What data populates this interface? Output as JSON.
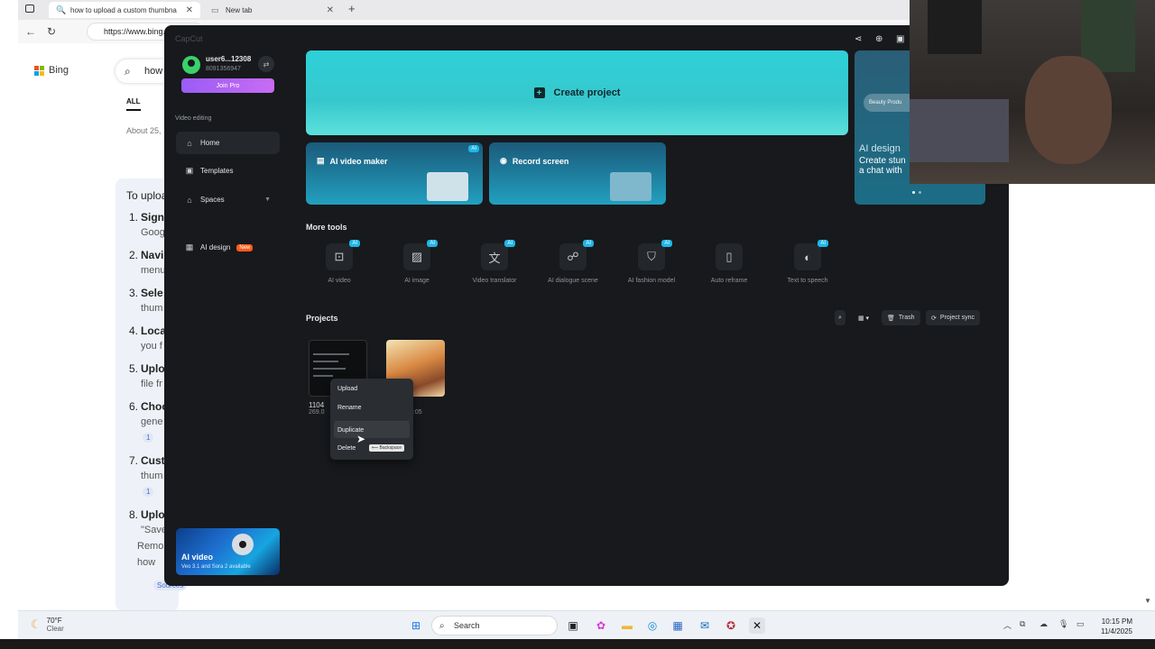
{
  "browser": {
    "tabs": [
      {
        "label": "how to upload a custom thumbna",
        "close": "✕"
      },
      {
        "label": "New tab",
        "close": "✕"
      }
    ],
    "new_tab": "+",
    "url": "https://www.bing.com"
  },
  "bing": {
    "logo": "Bing",
    "query": "how",
    "tab_all": "ALL",
    "about": "About 25,",
    "answer_intro": "To uploa",
    "steps": [
      {
        "num": "1.",
        "title": "Sign",
        "sub": "Goog"
      },
      {
        "num": "2.",
        "title": "Navi",
        "sub": "menu"
      },
      {
        "num": "3.",
        "title": "Sele",
        "sub": "thum"
      },
      {
        "num": "4.",
        "title": "Loca",
        "sub": "you f"
      },
      {
        "num": "5.",
        "title": "Uplo",
        "sub": "file fr"
      },
      {
        "num": "6.",
        "title": "Choo",
        "sub": "gene"
      },
      {
        "num": "7.",
        "title": "Custo",
        "sub": "thum"
      },
      {
        "num": "8.",
        "title": "Uplo",
        "sub": "\"Save"
      }
    ],
    "tail_lines": [
      "Remo",
      "how"
    ],
    "cites": [
      "1",
      "1"
    ],
    "sources": "Sources"
  },
  "capcut": {
    "brand": "CapCut",
    "user": {
      "name": "user6...12308",
      "id": "8091356947"
    },
    "join_pro": "Join Pro",
    "section_label": "Video editing",
    "nav": [
      {
        "label": "Home",
        "icon": "home-icon"
      },
      {
        "label": "Templates",
        "icon": "templates-icon"
      },
      {
        "label": "Spaces",
        "icon": "spaces-icon"
      },
      {
        "label": "AI design",
        "icon": "ai-design-icon",
        "badge": "New"
      }
    ],
    "promo": {
      "title": "AI video",
      "subtitle": "Veo 3.1 and Sora 2 available"
    },
    "create_project": "Create project",
    "features": [
      {
        "label": "AI video maker",
        "badge": "AI"
      },
      {
        "label": "Record screen"
      }
    ],
    "side_card": {
      "pill": "Beauty Produ",
      "title": "AI design",
      "text1": "Create stun",
      "text2": "a chat with"
    },
    "more_tools_heading": "More tools",
    "tools": [
      {
        "label": "AI video",
        "badge": "AI",
        "icon": "ai-video-icon"
      },
      {
        "label": "AI image",
        "badge": "AI",
        "icon": "ai-image-icon"
      },
      {
        "label": "Video translator",
        "badge": "AI",
        "icon": "translate-icon"
      },
      {
        "label": "AI dialogue scene",
        "badge": "AI",
        "icon": "dialogue-icon"
      },
      {
        "label": "AI fashion model",
        "badge": "AI",
        "icon": "fashion-icon"
      },
      {
        "label": "Auto reframe",
        "badge": "",
        "icon": "reframe-icon"
      },
      {
        "label": "Text to speech",
        "badge": "AI",
        "icon": "speech-icon"
      }
    ],
    "projects_heading": "Projects",
    "trash": "Trash",
    "project_sync": "Project sync",
    "projects": [
      {
        "name": "1104",
        "meta": "269.0"
      },
      {
        "name": "",
        "meta": "0:05"
      }
    ],
    "context_menu": {
      "items": [
        "Upload",
        "Rename",
        "Duplicate",
        "Delete"
      ],
      "delete_shortcut": "⟵ Backspace"
    }
  },
  "taskbar": {
    "temp": "70°F",
    "condition": "Clear",
    "search": "Search",
    "time": "10:15 PM",
    "date": "11/4/2025"
  }
}
